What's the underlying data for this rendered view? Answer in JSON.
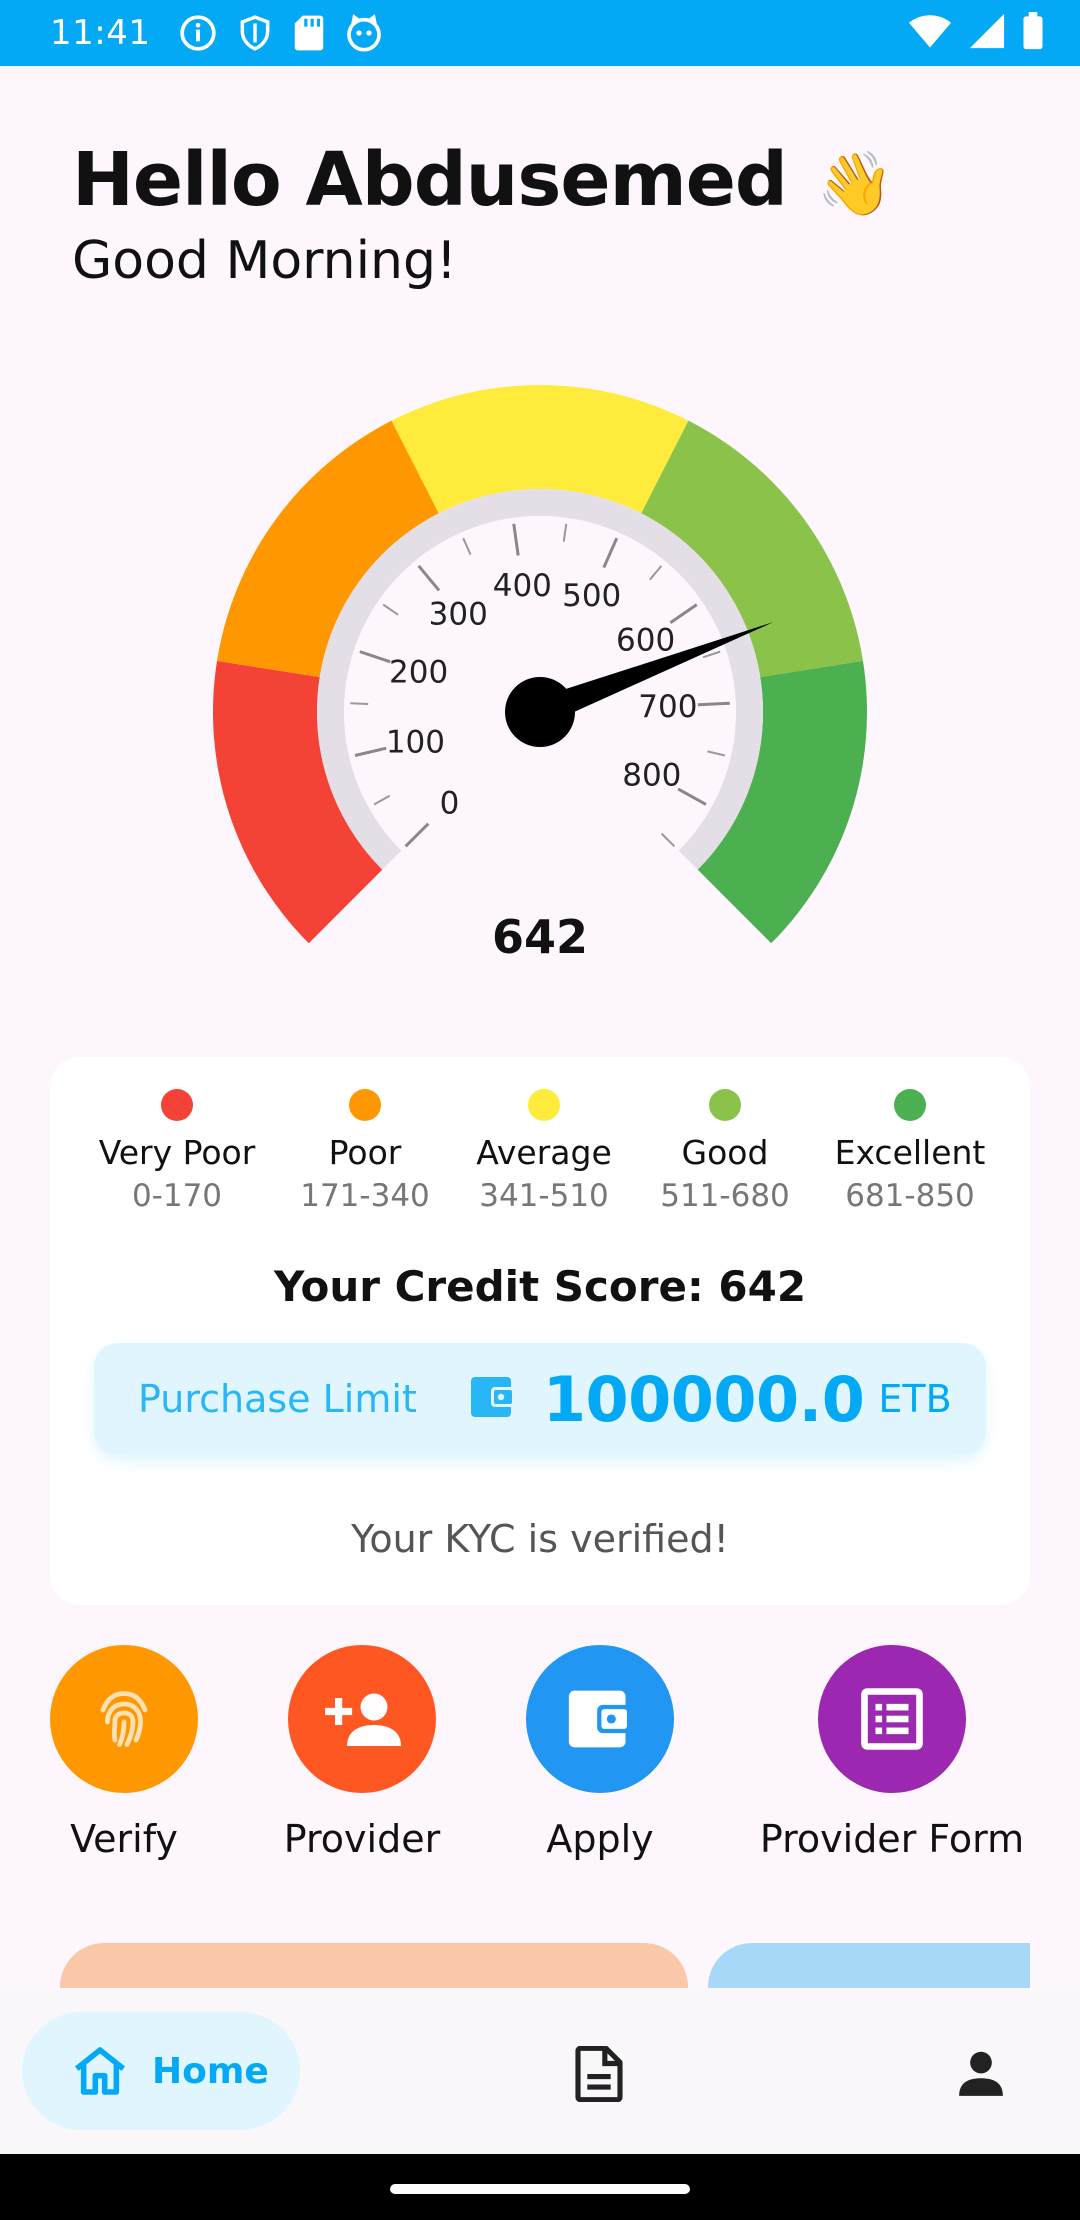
{
  "status_bar": {
    "time": "11:41",
    "left_icons": [
      "info-icon",
      "shield-icon",
      "sd-card-icon",
      "cat-icon"
    ],
    "right_icons": [
      "wifi-icon",
      "signal-icon",
      "battery-icon"
    ]
  },
  "greeting": {
    "title": "Hello Abdusemed",
    "emoji": "👋",
    "subtitle": "Good Morning!"
  },
  "gauge": {
    "score": "642",
    "score_value": 642,
    "min": 0,
    "max": 850,
    "tick_labels": [
      "0",
      "100",
      "200",
      "300",
      "400",
      "500",
      "600",
      "700",
      "800"
    ],
    "bands": [
      {
        "color": "#F44336"
      },
      {
        "color": "#FF9800"
      },
      {
        "color": "#FFEB3B"
      },
      {
        "color": "#8BC34A"
      },
      {
        "color": "#4CAF50"
      }
    ]
  },
  "legend": [
    {
      "label": "Very Poor",
      "range": "0-170",
      "color": "#F44336"
    },
    {
      "label": "Poor",
      "range": "171-340",
      "color": "#FF9800"
    },
    {
      "label": "Average",
      "range": "341-510",
      "color": "#FFEB3B"
    },
    {
      "label": "Good",
      "range": "511-680",
      "color": "#8BC34A"
    },
    {
      "label": "Excellent",
      "range": "681-850",
      "color": "#4CAF50"
    }
  ],
  "credit": {
    "score_text": "Your Credit Score: 642",
    "purchase_label": "Purchase Limit",
    "amount": "100000.0",
    "currency": "ETB",
    "kyc_status": "Your KYC is verified!"
  },
  "actions": [
    {
      "label": "Verify",
      "icon": "fingerprint-icon",
      "color": "#FF9800"
    },
    {
      "label": "Provider",
      "icon": "person-add-icon",
      "color": "#FF5722"
    },
    {
      "label": "Apply",
      "icon": "wallet-icon",
      "color": "#2196F3"
    },
    {
      "label": "Provider Form",
      "icon": "form-list-icon",
      "color": "#9C27B0"
    }
  ],
  "bottom_nav": {
    "home_label": "Home",
    "items": [
      "home-icon",
      "document-icon",
      "profile-icon"
    ]
  },
  "colors": {
    "accent": "#03A9F4",
    "background": "#FDF7FD"
  }
}
